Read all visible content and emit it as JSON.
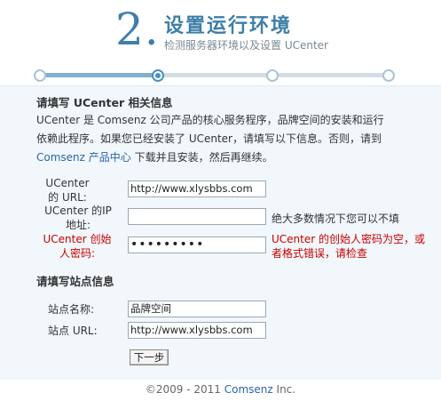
{
  "header": {
    "step_number": "2.",
    "title": "设置运行环境",
    "subtitle": "检测服务器环境以及设置 UCenter"
  },
  "progress": {
    "total_steps": 4,
    "current_step": 2
  },
  "ucenter_section": {
    "title": "请填写 UCenter 相关信息",
    "intro_line1": "UCenter 是 Comsenz 公司产品的核心服务程序，品牌空间的安装和运行",
    "intro_line2": "依赖此程序。如果您已经安装了 UCenter，请填写以下信息。否则，请到",
    "intro_link": "Comsenz 产品中心",
    "intro_line3_rest": " 下载并且安装，然后再继续。",
    "fields": {
      "url_label": "UCenter 的 URL:",
      "url_value": "http://www.xlysbbs.com",
      "ip_label": "UCenter 的IP 地址:",
      "ip_value": "",
      "ip_hint": "绝大多数情况下您可以不填",
      "password_label": "UCenter 创始人密码:",
      "password_value": "•••••••••",
      "password_error": "UCenter 的创始人密码为空，或者格式错误，请检查"
    }
  },
  "site_section": {
    "title": "请填写站点信息",
    "name_label": "站点名称:",
    "name_value": "品牌空间",
    "url_label": "站点 URL:",
    "url_value": "http://www.xlysbbs.com"
  },
  "next_button": "下一步",
  "footer": {
    "copyright": "©2009 - 2011 ",
    "brand": "Comsenz",
    "suffix": " Inc."
  },
  "colors": {
    "accent": "#3f7fa8",
    "link": "#2767a6",
    "error": "#c60000",
    "content_bg": "#f2f7fb"
  }
}
